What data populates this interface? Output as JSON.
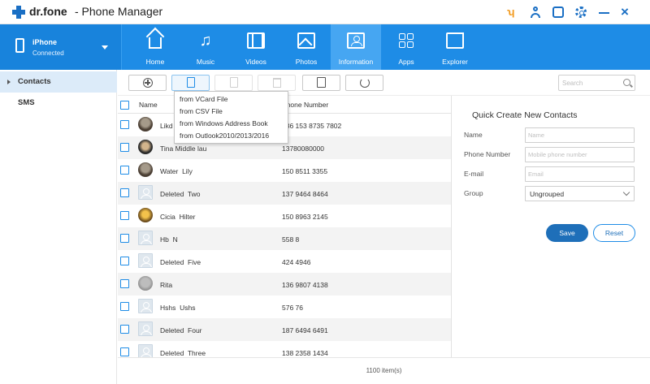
{
  "app": {
    "brand": "dr.fone",
    "title": "- Phone Manager"
  },
  "icons": {
    "cart": "cart-icon",
    "user": "user-icon",
    "feedback": "feedback-icon",
    "settings": "gear-icon",
    "minimize": "minimize-icon",
    "close": "close-icon"
  },
  "colors": {
    "primary": "#1e8ce6",
    "active_tab": "#46a6f2",
    "save_button": "#1e6fb9",
    "sidebar_active": "#dcebf9"
  },
  "device": {
    "name": "iPhone",
    "status": "Connected"
  },
  "nav": {
    "tabs": [
      {
        "label": "Home"
      },
      {
        "label": "Music"
      },
      {
        "label": "Videos"
      },
      {
        "label": "Photos"
      },
      {
        "label": "Information",
        "active": true
      },
      {
        "label": "Apps"
      },
      {
        "label": "Explorer"
      }
    ]
  },
  "sidebar": {
    "items": [
      {
        "label": "Contacts",
        "active": true
      },
      {
        "label": "SMS"
      }
    ]
  },
  "toolbar": {
    "search_placeholder": "Search"
  },
  "import_menu": {
    "items": [
      "from VCard File",
      "from CSV File",
      "from Windows Address  Book",
      "from Outlook2010/2013/2016"
    ]
  },
  "table": {
    "headers": {
      "name": "Name",
      "phone": "Phone Number"
    },
    "rows": [
      {
        "name": "Likd",
        "phone": "186 153 8735 7802"
      },
      {
        "name": "Tina Middle lau",
        "phone": "13780080000"
      },
      {
        "name": "Water  Lily",
        "phone": "150 8511 3355"
      },
      {
        "name": "Deleted  Two",
        "phone": "137 9464 8464"
      },
      {
        "name": "Cicia  Hilter",
        "phone": "150 8963 2145"
      },
      {
        "name": "Hb  N",
        "phone": "558 8"
      },
      {
        "name": "Deleted  Five",
        "phone": "424 4946"
      },
      {
        "name": "Rita",
        "phone": "136 9807 4138"
      },
      {
        "name": "Hshs  Ushs",
        "phone": "576 76"
      },
      {
        "name": "Deleted  Four",
        "phone": "187 6494 6491"
      },
      {
        "name": "Deleted  Three",
        "phone": "138 2358 1434"
      }
    ]
  },
  "status": {
    "count": "1100  item(s)"
  },
  "quick_create": {
    "title": "Quick Create New Contacts",
    "name_label": "Name",
    "name_placeholder": "Name",
    "phone_label": "Phone Number",
    "phone_placeholder": "Mobile phone number",
    "email_label": "E-mail",
    "email_placeholder": "Email",
    "group_label": "Group",
    "group_value": "Ungrouped",
    "save_label": "Save",
    "reset_label": "Reset"
  }
}
